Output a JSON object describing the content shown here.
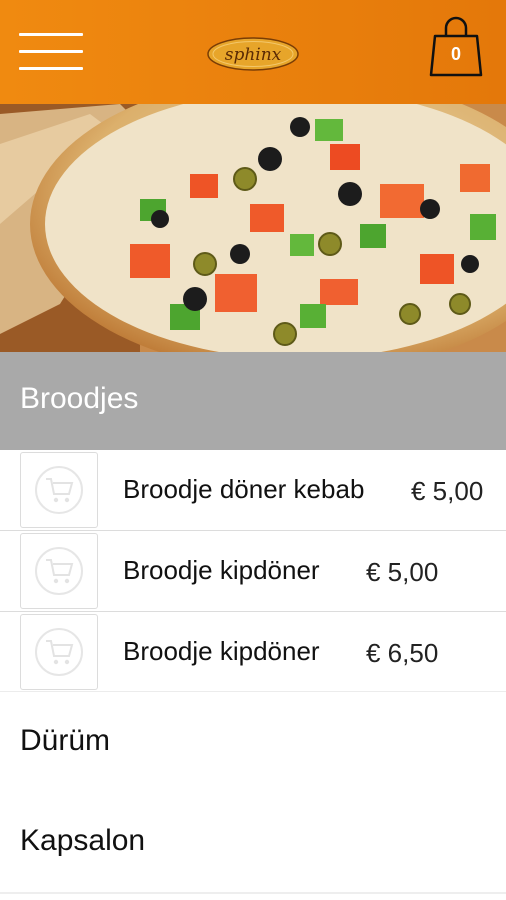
{
  "header": {
    "menu_icon": "hamburger-icon",
    "logo_text": "sphinx",
    "cart_icon": "shopping-bag-icon",
    "cart_count": "0",
    "background_color": "#ec8210"
  },
  "hero": {
    "image": "vegetable-pizza-photo"
  },
  "active_category": {
    "label": "Broodjes",
    "background_color": "#a9a9a9"
  },
  "items": [
    {
      "name": "Broodje döner kebab",
      "price": "€ 5,00",
      "add_icon": "add-to-cart-icon"
    },
    {
      "name": "Broodje kipdöner",
      "price": "€ 5,00",
      "add_icon": "add-to-cart-icon"
    },
    {
      "name": "Broodje kipdöner",
      "price": "€ 6,50",
      "add_icon": "add-to-cart-icon"
    }
  ],
  "categories": [
    {
      "label": "Dürüm"
    },
    {
      "label": "Kapsalon"
    }
  ]
}
